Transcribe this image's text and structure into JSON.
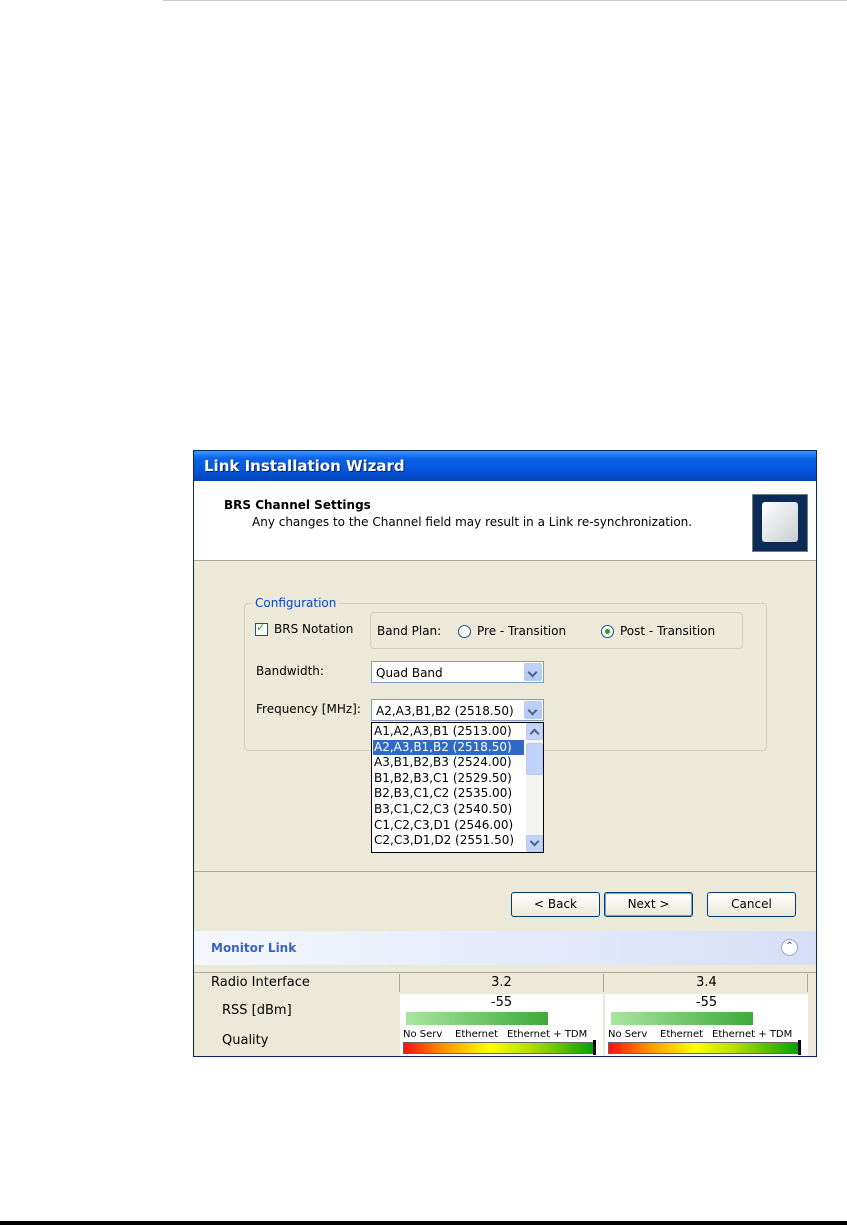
{
  "window": {
    "title": "Link Installation Wizard"
  },
  "header": {
    "title": "BRS Channel Settings",
    "subtitle": "Any changes to the Channel field may result in a Link re-synchronization.",
    "image_icon": "antenna-panel-icon"
  },
  "configuration": {
    "legend": "Configuration",
    "brs_notation": {
      "label": "BRS Notation",
      "checked": true
    },
    "band_plan": {
      "label": "Band Plan:",
      "options": [
        "Pre - Transition",
        "Post - Transition"
      ],
      "selected": "Post - Transition"
    },
    "bandwidth": {
      "label": "Bandwidth:",
      "value": "Quad Band"
    },
    "frequency": {
      "label": "Frequency [MHz]:",
      "value": "A2,A3,B1,B2 (2518.50)",
      "options": [
        "A1,A2,A3,B1 (2513.00)",
        "A2,A3,B1,B2 (2518.50)",
        "A3,B1,B2,B3 (2524.00)",
        "B1,B2,B3,C1 (2529.50)",
        "B2,B3,C1,C2 (2535.00)",
        "B3,C1,C2,C3 (2540.50)",
        "C1,C2,C3,D1 (2546.00)",
        "C2,C3,D1,D2 (2551.50)"
      ],
      "selected_index": 1
    }
  },
  "buttons": {
    "back": "< Back",
    "next": "Next >",
    "cancel": "Cancel"
  },
  "monitor": {
    "title": "Monitor Link",
    "rows": {
      "radio_interface": "Radio Interface",
      "rss": "RSS [dBm]",
      "quality": "Quality"
    },
    "columns": [
      {
        "name": "3.2",
        "rss": "-55"
      },
      {
        "name": "3.4",
        "rss": "-55"
      }
    ],
    "quality_labels": [
      "No Serv",
      "Ethernet",
      "Ethernet + TDM"
    ]
  },
  "colors": {
    "accent": "#0553d8",
    "selection": "#316ac5",
    "monitor_title": "#3a64b9"
  }
}
